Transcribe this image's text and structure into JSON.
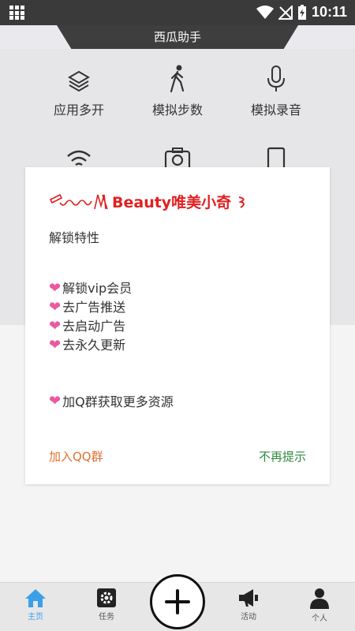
{
  "status_bar": {
    "time": "10:11"
  },
  "title_bar": {
    "title": "西瓜助手"
  },
  "grid": {
    "items": [
      {
        "label": "应用多开",
        "icon": "layers-icon"
      },
      {
        "label": "模拟步数",
        "icon": "walking-icon"
      },
      {
        "label": "模拟录音",
        "icon": "microphone-icon"
      },
      {
        "label": "",
        "icon": "wifi-icon"
      },
      {
        "label": "",
        "icon": "camera-icon"
      },
      {
        "label": "",
        "icon": "phone-icon"
      }
    ]
  },
  "dialog": {
    "title": "Beauty唯美小奇",
    "subtitle": "解锁特性",
    "features": [
      "解锁vip会员",
      "去广告推送",
      "去启动广告",
      "去永久更新"
    ],
    "extra": "加Q群获取更多资源",
    "join_button": "加入QQ群",
    "dismiss_button": "不再提示"
  },
  "nav": {
    "home": "主页",
    "tasks": "任务",
    "activity": "活动",
    "profile": "个人",
    "active": "home"
  },
  "colors": {
    "accent": "#3aa0e8",
    "dialog_title": "#e02020",
    "heart": "#ea5aa0",
    "join": "#e07030",
    "dismiss": "#2e8a3e"
  }
}
